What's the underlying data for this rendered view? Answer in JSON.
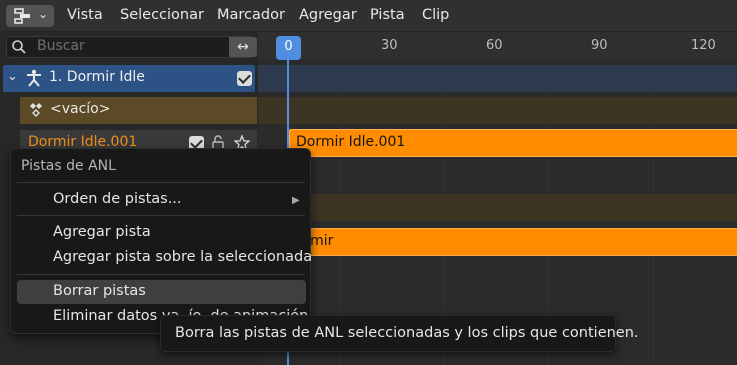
{
  "header": {
    "editor_type_icon": "nla-editor-icon",
    "menus": [
      "Vista",
      "Seleccionar",
      "Marcador",
      "Agregar",
      "Pista",
      "Clip"
    ]
  },
  "channels": {
    "search": {
      "placeholder": "Buscar"
    },
    "object": {
      "label": "1. Dormir Idle"
    },
    "action_slot": {
      "label": "<vacío>"
    },
    "track": {
      "label": "Dormir Idle.001"
    }
  },
  "timeline": {
    "current_frame": "0",
    "ticks": [
      "30",
      "60",
      "90",
      "120"
    ],
    "clips": [
      "Dormir Idle.001",
      "ormir"
    ]
  },
  "context_menu": {
    "title": "Pistas de ANL",
    "items": {
      "track_order": "Orden de pistas...",
      "add_track": "Agregar pista",
      "add_track_above": "Agregar pista sobre la seleccionada",
      "delete_tracks": "Borrar pistas",
      "remove_empty": "Eliminar datos va..ío. de animación"
    }
  },
  "tooltip": {
    "text": "Borra las pistas de ANL seleccionadas y los clips que contienen."
  },
  "colors": {
    "accent_blue": "#4f8ee0",
    "clip_orange": "#ff8c00",
    "selected_row": "#2d5286",
    "action_row": "#5b4a25"
  }
}
